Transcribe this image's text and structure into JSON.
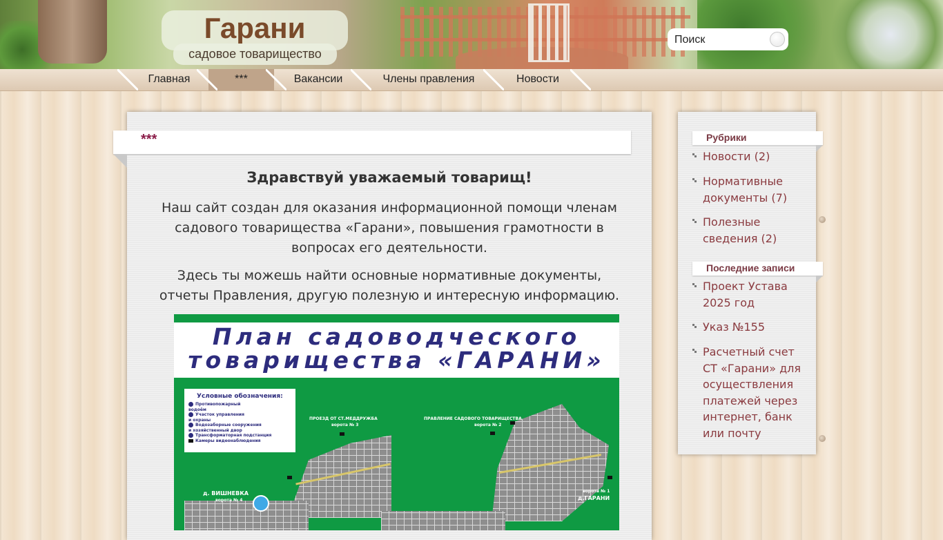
{
  "site": {
    "title": "Гарани",
    "subtitle": "садовое товарищество"
  },
  "search": {
    "placeholder": "Поиск"
  },
  "nav": {
    "items": [
      {
        "label": "Главная"
      },
      {
        "label": "***",
        "active": true
      },
      {
        "label": "Вакансии"
      },
      {
        "label": "Члены правления"
      },
      {
        "label": "Новости"
      }
    ]
  },
  "post": {
    "title": "***",
    "greeting": "Здравствуй уважаемый товарищ!",
    "paragraph1": "Наш сайт создан для оказания информационной помощи членам садового товарищества «Гарани», повышения грамотности в вопросах его деятельности.",
    "paragraph2": "Здесь ты можешь найти основные нормативные документы, отчеты Правления, другую полезную и интересную информацию."
  },
  "map": {
    "title_line1": "План садоводческого",
    "title_line2": "товарищества «ГАРАНИ»",
    "legend_title": "Условные обозначения:",
    "legend_items": [
      {
        "num": "1",
        "text": "Противопожарный\nводоём"
      },
      {
        "num": "2",
        "text": "Участок управления\nи охраны"
      },
      {
        "num": "3",
        "text": "Водозаборные сооружения\nи хозяйственный двор"
      },
      {
        "num": "4",
        "text": "Трансформаторная подстанция"
      },
      {
        "num": "cam",
        "text": "Камеры видеонаблюдения"
      }
    ],
    "labels": {
      "passage": "ПРОЕЗД ОТ СТ.МЕДДРУЖБА",
      "gate3": "ворота № 3",
      "board": "ПРАВЛЕНИЕ САДОВОГО ТОВАРИЩЕСТВА",
      "gate2": "ворота № 2",
      "village1": "д. ВИШНЕВКА",
      "gate4": "ворота № 4",
      "gate1": "ворота № 1",
      "village2": "д.ГАРАНИ"
    },
    "colors": {
      "background": "#0f9a43",
      "title": "#2d2c7d"
    }
  },
  "sidebar": {
    "categories_title": "Рубрики",
    "categories": [
      {
        "label": "Новости (2)"
      },
      {
        "label": "Нормативные документы (7)"
      },
      {
        "label": "Полезные сведения (2)"
      }
    ],
    "recent_title": "Последние записи",
    "recent": [
      {
        "label": "Проект Устава 2025 год"
      },
      {
        "label": "Указ №155"
      },
      {
        "label": "Расчетный счет СТ «Гарани» для осуществления платежей через интернет, банк или почту"
      }
    ]
  },
  "colors": {
    "title_brown": "#7a4a2a",
    "post_title": "#8b1d49",
    "link": "#8a3a3f",
    "widget_title": "#7a3a44"
  }
}
